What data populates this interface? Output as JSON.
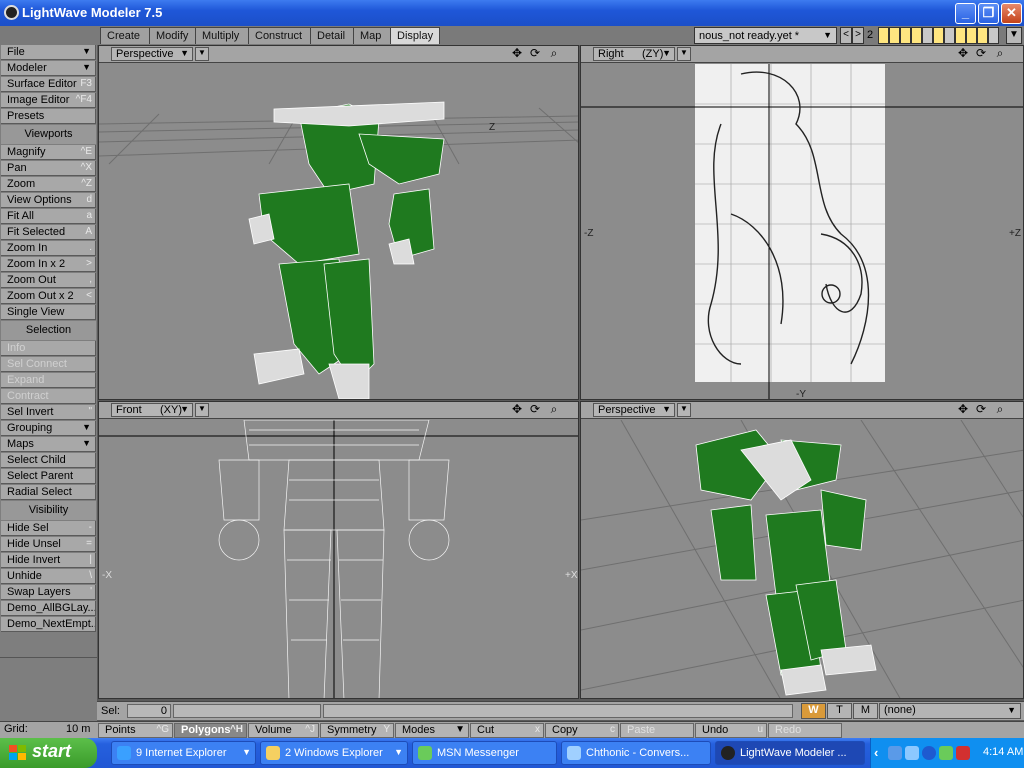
{
  "window": {
    "title": "LightWave Modeler 7.5"
  },
  "tabs": [
    {
      "label": "Create"
    },
    {
      "label": "Modify"
    },
    {
      "label": "Multiply"
    },
    {
      "label": "Construct"
    },
    {
      "label": "Detail"
    },
    {
      "label": "Map"
    },
    {
      "label": "Display"
    }
  ],
  "layer_selector": {
    "value": "nous_not ready.yet *",
    "number": "2"
  },
  "left_panel": [
    {
      "label": "File",
      "type": "dropdown"
    },
    {
      "label": "Modeler",
      "type": "dropdown"
    },
    {
      "label": "Surface Editor",
      "key": "F3"
    },
    {
      "label": "Image Editor",
      "key": "^F4"
    },
    {
      "label": "Presets"
    },
    {
      "label": "Viewports",
      "type": "header"
    },
    {
      "label": "Magnify",
      "key": "^E"
    },
    {
      "label": "Pan",
      "key": "^X"
    },
    {
      "label": "Zoom",
      "key": "^Z"
    },
    {
      "label": "View Options",
      "key": "d"
    },
    {
      "label": "Fit All",
      "key": "a"
    },
    {
      "label": "Fit Selected",
      "key": "A"
    },
    {
      "label": "Zoom In",
      "key": "."
    },
    {
      "label": "Zoom In x 2",
      "key": ">"
    },
    {
      "label": "Zoom Out",
      "key": ","
    },
    {
      "label": "Zoom Out x 2",
      "key": "<"
    },
    {
      "label": "Single View"
    },
    {
      "label": "Selection",
      "type": "header"
    },
    {
      "label": "Info",
      "disabled": true
    },
    {
      "label": "Sel Connect",
      "disabled": true
    },
    {
      "label": "Expand",
      "disabled": true
    },
    {
      "label": "Contract",
      "disabled": true
    },
    {
      "label": "Sel Invert",
      "key": "\""
    },
    {
      "label": "Grouping",
      "type": "dropdown"
    },
    {
      "label": "Maps",
      "type": "dropdown"
    },
    {
      "label": "Select Child"
    },
    {
      "label": "Select Parent"
    },
    {
      "label": "Radial Select"
    },
    {
      "label": "Visibility",
      "type": "header"
    },
    {
      "label": "Hide Sel",
      "key": "-"
    },
    {
      "label": "Hide Unsel",
      "key": "="
    },
    {
      "label": "Hide Invert",
      "key": "|"
    },
    {
      "label": "Unhide",
      "key": "\\"
    },
    {
      "label": "Swap Layers",
      "key": "'"
    },
    {
      "label": "Demo_AllBGLay..."
    },
    {
      "label": "Demo_NextEmpt..."
    }
  ],
  "viewports": {
    "top_left": {
      "title": "Perspective",
      "axis_label": "Z"
    },
    "top_right": {
      "title": "Right",
      "axes": "(ZY)",
      "left_axis": "-Z",
      "right_axis": "+Z",
      "bottom_axis": "-Y"
    },
    "bottom_left": {
      "title": "Front",
      "axes": "(XY)",
      "left_axis": "-X",
      "right_axis": "+X"
    },
    "bottom_right": {
      "title": "Perspective"
    }
  },
  "selbar": {
    "label": "Sel:",
    "value": "0"
  },
  "wtm": {
    "w": "W",
    "t": "T",
    "m": "M",
    "value": "(none)"
  },
  "grid": {
    "label": "Grid:",
    "value": "10 m"
  },
  "toolbar": [
    {
      "label": "Points",
      "key": "^G"
    },
    {
      "label": "Polygons",
      "key": "^H",
      "active": true
    },
    {
      "label": "Volume",
      "key": "^J"
    },
    {
      "label": "Symmetry",
      "key": "Y"
    },
    {
      "label": "Modes",
      "type": "dropdown"
    },
    {
      "label": "Cut",
      "key": "x"
    },
    {
      "label": "Copy",
      "key": "c"
    },
    {
      "label": "Paste",
      "disabled": true
    },
    {
      "label": "Undo",
      "key": "u"
    },
    {
      "label": "Redo",
      "disabled": true
    }
  ],
  "taskbar": {
    "start": "start",
    "tasks": [
      {
        "label": "9 Internet Explorer"
      },
      {
        "label": "2 Windows Explorer"
      },
      {
        "label": "MSN Messenger"
      },
      {
        "label": "Chthonic - Convers..."
      },
      {
        "label": "LightWave Modeler ..."
      }
    ],
    "clock": "4:14 AM"
  },
  "colors": {
    "mesh_green": "#1f7a1f",
    "viewport_bg": "#8c8c8c",
    "xp_blue": "#2157d4",
    "start_green": "#3a9b2a"
  }
}
